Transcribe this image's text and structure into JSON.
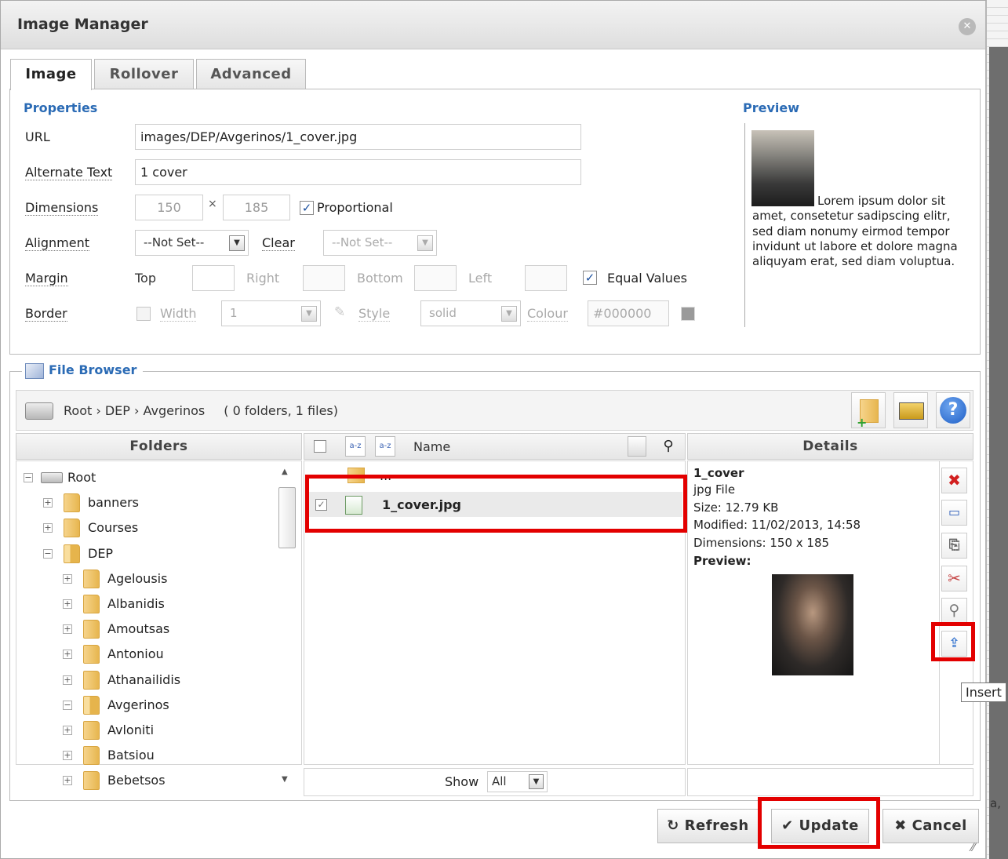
{
  "dialog": {
    "title": "Image Manager",
    "close_icon": "close-icon"
  },
  "tabs": [
    {
      "label": "Image",
      "active": true
    },
    {
      "label": "Rollover",
      "active": false
    },
    {
      "label": "Advanced",
      "active": false
    }
  ],
  "properties": {
    "heading": "Properties",
    "url_label": "URL",
    "url_value": "images/DEP/Avgerinos/1_cover.jpg",
    "alt_label": "Alternate Text",
    "alt_value": "1 cover",
    "dimensions_label": "Dimensions",
    "width_value": "150",
    "times": "×",
    "height_value": "185",
    "proportional_label": "Proportional",
    "proportional_checked": true,
    "alignment_label": "Alignment",
    "alignment_value": "--Not Set--",
    "clear_label": "Clear",
    "clear_value": "--Not Set--",
    "margin_label": "Margin",
    "top_label": "Top",
    "right_label": "Right",
    "bottom_label": "Bottom",
    "left_label": "Left",
    "equal_values_label": "Equal Values",
    "equal_values_checked": true,
    "border_label": "Border",
    "border_width_label": "Width",
    "border_width_value": "1",
    "border_style_label": "Style",
    "border_style_value": "solid",
    "border_colour_label": "Colour",
    "border_colour_value": "#000000"
  },
  "preview": {
    "heading": "Preview",
    "text": "Lorem ipsum dolor sit amet, consetetur sadipscing elitr, sed diam nonumy eirmod tempor invidunt ut labore et dolore magna aliquyam erat, sed diam voluptua."
  },
  "file_browser": {
    "legend": "File Browser",
    "path": "Root › DEP › Avgerinos",
    "count": "( 0 folders, 1 files)",
    "folders_header": "Folders",
    "name_header": "Name",
    "details_header": "Details",
    "show_label": "Show",
    "show_value": "All",
    "folders": [
      {
        "label": "Root",
        "level": 0,
        "expander": "−"
      },
      {
        "label": "banners",
        "level": 1,
        "expander": "+"
      },
      {
        "label": "Courses",
        "level": 1,
        "expander": "+"
      },
      {
        "label": "DEP",
        "level": 1,
        "expander": "−"
      },
      {
        "label": "Agelousis",
        "level": 2,
        "expander": "+"
      },
      {
        "label": "Albanidis",
        "level": 2,
        "expander": "+"
      },
      {
        "label": "Amoutsas",
        "level": 2,
        "expander": "+"
      },
      {
        "label": "Antoniou",
        "level": 2,
        "expander": "+"
      },
      {
        "label": "Athanailidis",
        "level": 2,
        "expander": "+"
      },
      {
        "label": "Avgerinos",
        "level": 2,
        "expander": "−"
      },
      {
        "label": "Avloniti",
        "level": 2,
        "expander": "+"
      },
      {
        "label": "Batsiou",
        "level": 2,
        "expander": "+"
      },
      {
        "label": "Bebetsos",
        "level": 2,
        "expander": "+"
      }
    ],
    "files": [
      {
        "name": "...",
        "type": "parent"
      },
      {
        "name": "1_cover.jpg",
        "type": "image",
        "selected": true
      }
    ],
    "details": {
      "name": "1_cover",
      "type": "jpg File",
      "size": "Size: 12.79 KB",
      "modified": "Modified: 11/02/2013, 14:58",
      "dimensions": "Dimensions: 150 x 185",
      "preview_label": "Preview:"
    },
    "tooltip": "Insert"
  },
  "buttons": {
    "refresh": "Refresh",
    "refresh_icon": "↻",
    "update": "Update",
    "update_icon": "✔",
    "cancel": "Cancel",
    "cancel_icon": "✖"
  },
  "backdrop_text": "a, ",
  "colors": {
    "heading_blue": "#2b6bb5",
    "highlight_red": "#e30000",
    "delete_red": "#d21f1f"
  }
}
